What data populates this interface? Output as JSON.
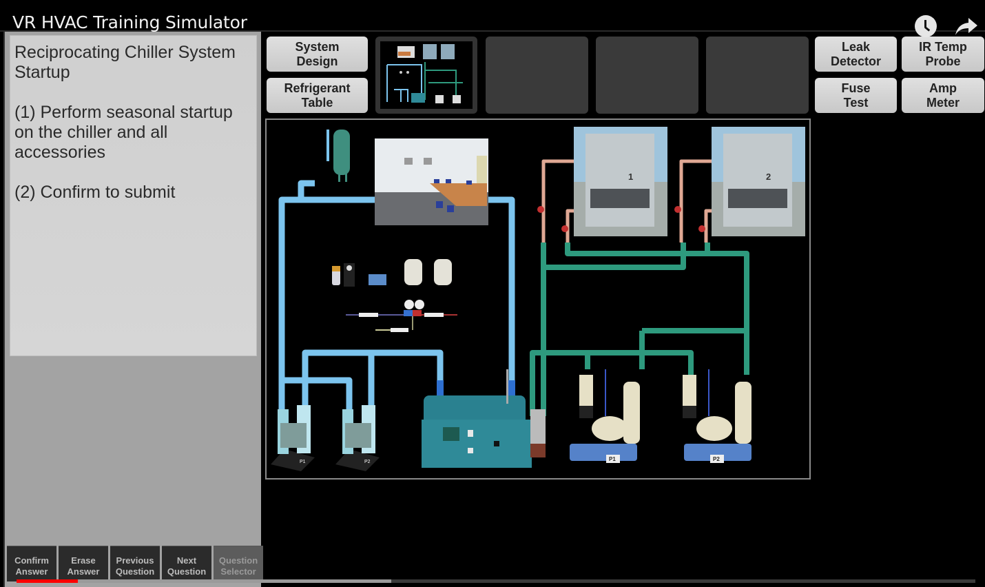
{
  "video": {
    "title": "VR HVAC Training Simulator",
    "icons": [
      "watch-later-icon",
      "share-icon"
    ],
    "progress": {
      "played_percent": 6.4,
      "buffered_percent": 39.1,
      "played_color": "#ff0000"
    }
  },
  "question": {
    "title": "Reciprocating Chiller System Startup",
    "steps": [
      "(1) Perform seasonal startup on the chiller and all accessories",
      "(2) Confirm to submit"
    ]
  },
  "bottom_buttons": [
    {
      "line1": "Confirm",
      "line2": "Answer"
    },
    {
      "line1": "Erase",
      "line2": "Answer"
    },
    {
      "line1": "Previous",
      "line2": "Question"
    },
    {
      "line1": "Next",
      "line2": "Question"
    },
    {
      "line1": "Question",
      "line2": "Selector",
      "active": true
    }
  ],
  "toolbar": {
    "left": [
      {
        "line1": "System",
        "line2": "Design"
      },
      {
        "line1": "Refrigerant",
        "line2": "Table"
      }
    ],
    "right": [
      {
        "line1": "Leak",
        "line2": "Detector"
      },
      {
        "line1": "IR Temp",
        "line2": "Probe"
      },
      {
        "line1": "Fuse",
        "line2": "Test"
      },
      {
        "line1": "Amp",
        "line2": "Meter"
      }
    ],
    "thumbnails": {
      "active_index": 0,
      "empty_slots": 3
    }
  },
  "diagram": {
    "colors": {
      "chilled_water_pipe": "#7cc4ee",
      "chilled_water_dark": "#2e6fd0",
      "condenser_water_pipe": "#2e9a7e",
      "hot_pipe": "#e0a894",
      "chiller_body": "#2f8a98"
    },
    "cooling_tower_labels": [
      "1",
      "2"
    ],
    "condenser_pump_labels": [
      "P1",
      "P2"
    ],
    "chilled_pump_labels": [
      "P1",
      "P2"
    ]
  }
}
